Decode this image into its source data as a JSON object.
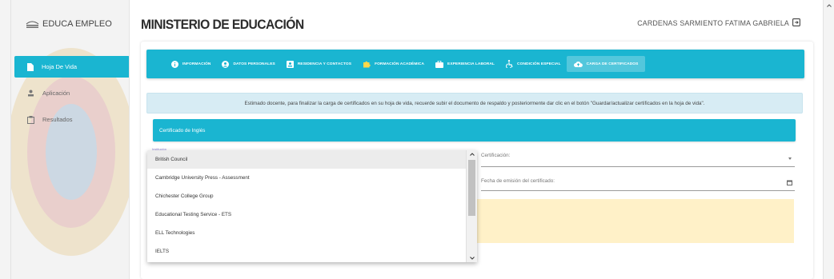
{
  "sidebar": {
    "brand": "EDUCA EMPLEO",
    "items": [
      {
        "label": "Hoja De Vida",
        "icon": "document-icon",
        "active": true
      },
      {
        "label": "Aplicación",
        "icon": "person-icon",
        "active": false
      },
      {
        "label": "Resultados",
        "icon": "clipboard-icon",
        "active": false
      }
    ]
  },
  "header": {
    "title": "MINISTERIO DE EDUCACIÓN",
    "user": "CARDENAS SARMIENTO FATIMA GABRIELA"
  },
  "tabs": [
    {
      "label": "INFORMACIÓN",
      "icon": "info-icon"
    },
    {
      "label": "DATOS PERSONALES",
      "icon": "account-icon"
    },
    {
      "label": "RESIDENCIA Y CONTACTOS",
      "icon": "contact-card-icon"
    },
    {
      "label": "FORMACIÓN ACADÉMICA",
      "icon": "puzzle-icon"
    },
    {
      "label": "EXPERIENCIA LABORAL",
      "icon": "briefcase-icon"
    },
    {
      "label": "CONDICIÓN ESPECIAL",
      "icon": "accessibility-icon"
    },
    {
      "label": "CARGA DE CERTIFICADOS",
      "icon": "cloud-upload-icon",
      "active": true
    }
  ],
  "alert": {
    "text": "Estimado docente, para finalizar la carga de certificados en su hoja de vida, recuerde subir el documento de respaldo y posteriormente dar clic en el botón \"Guardar/actualizar certificados en la hoja de vida\"."
  },
  "section": {
    "title": "Certificado de Inglés"
  },
  "form": {
    "provider_label": "Institución",
    "provider_options": [
      "British Council",
      "Cambridge University Press - Assessment",
      "Chichester College Group",
      "Educational Testing Service - ETS",
      "ELL Technologies",
      "IELTS"
    ],
    "certification_label": "Certificación:",
    "date_label": "Fecha de emisión del certificado:"
  },
  "colors": {
    "accent": "#1ab5d1",
    "alert_bg": "#d7ecf4",
    "warning_bg": "#fff1c8"
  }
}
